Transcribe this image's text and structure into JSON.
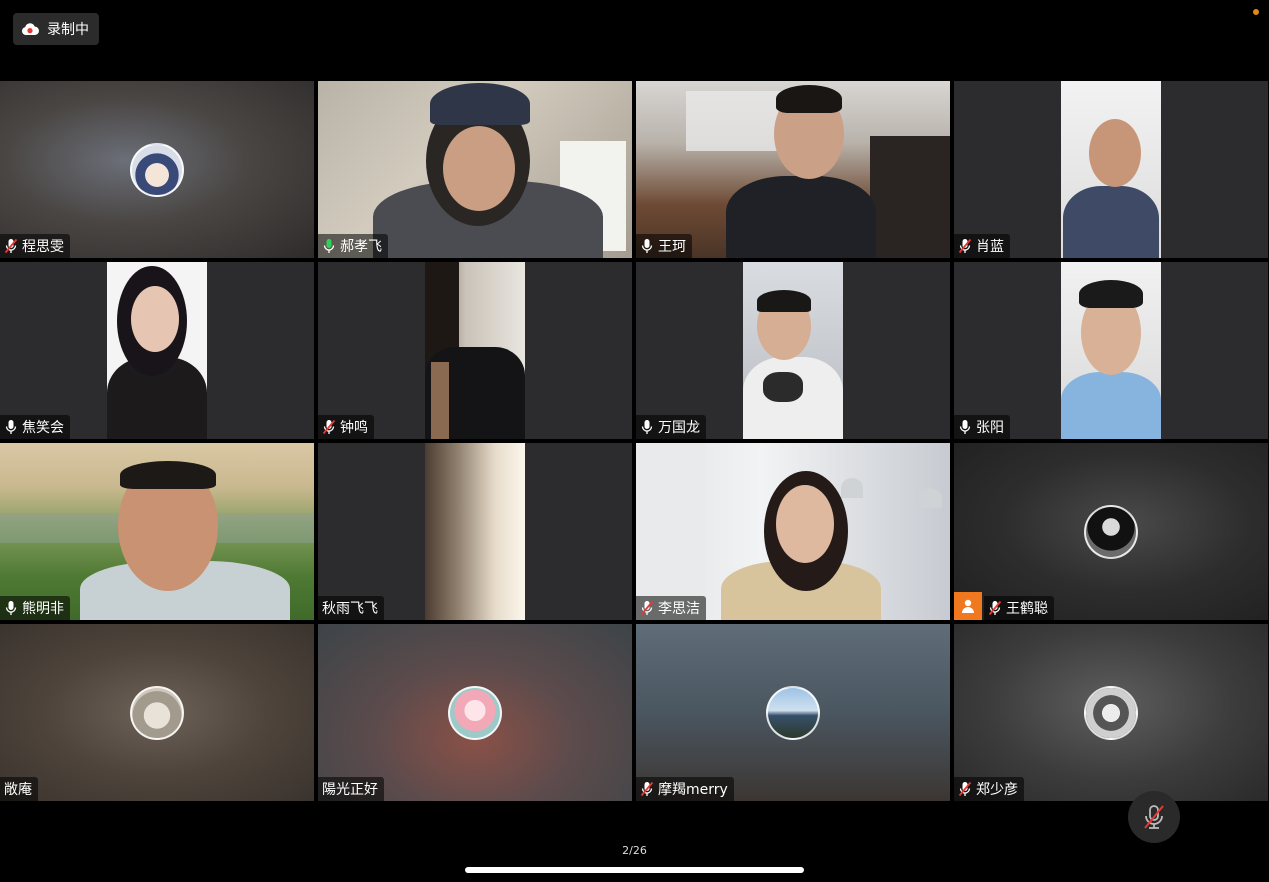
{
  "recording": {
    "label": "录制中",
    "icon": "cloud-record-icon",
    "accent": "#e53935"
  },
  "status_dot_color": "#e08a12",
  "speaking_color": "#2fd15a",
  "participants": [
    {
      "name": "程思雯",
      "mic": "muted",
      "view": "avatar"
    },
    {
      "name": "郝孝飞",
      "mic": "speaking",
      "view": "video",
      "active_speaker": true
    },
    {
      "name": "王珂",
      "mic": "on",
      "view": "video"
    },
    {
      "name": "肖蓝",
      "mic": "muted",
      "view": "video"
    },
    {
      "name": "焦笑会",
      "mic": "on",
      "view": "video"
    },
    {
      "name": "钟鸣",
      "mic": "muted",
      "view": "video"
    },
    {
      "name": "万国龙",
      "mic": "on",
      "view": "video"
    },
    {
      "name": "张阳",
      "mic": "on",
      "view": "video"
    },
    {
      "name": "熊明非",
      "mic": "on",
      "view": "video"
    },
    {
      "name": "秋雨飞飞",
      "mic": "none",
      "view": "video"
    },
    {
      "name": "李思洁",
      "mic": "muted",
      "view": "video"
    },
    {
      "name": "王鹤聪",
      "mic": "muted",
      "view": "avatar",
      "host": true
    },
    {
      "name": "敞庵",
      "mic": "none",
      "view": "avatar"
    },
    {
      "name": "陽光正好",
      "mic": "none",
      "view": "avatar"
    },
    {
      "name": "摩羯merry",
      "mic": "muted",
      "view": "avatar"
    },
    {
      "name": "郑少彦",
      "mic": "muted",
      "view": "avatar"
    }
  ],
  "pagination": "2/26",
  "controls": {
    "mute_button_icon": "mic-off-icon"
  }
}
